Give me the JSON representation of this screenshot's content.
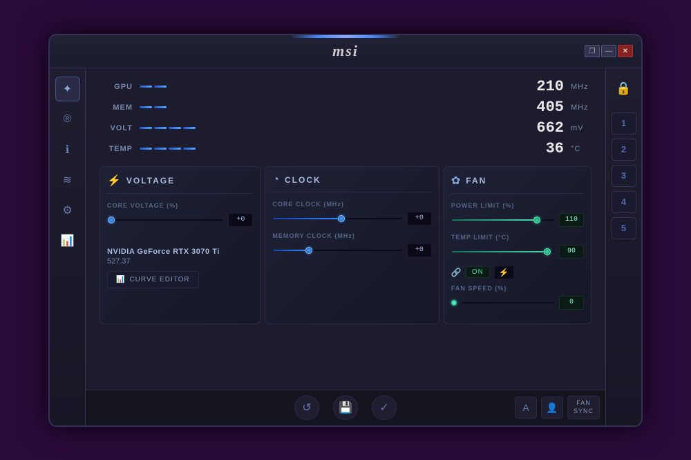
{
  "window": {
    "title": "msi",
    "controls": {
      "minimize": "—",
      "restore": "❐",
      "close": "✕"
    }
  },
  "metrics": [
    {
      "label": "GPU",
      "value": "210",
      "unit": "MHz",
      "barPercent": 15
    },
    {
      "label": "MEM",
      "value": "405",
      "unit": "MHz",
      "barPercent": 25
    },
    {
      "label": "VOLT",
      "value": "662",
      "unit": "mV",
      "barPercent": 35
    },
    {
      "label": "TEMP",
      "value": "36",
      "unit": "°C",
      "barPercent": 30
    }
  ],
  "panels": {
    "voltage": {
      "title": "VOLTAGE",
      "icon": "⚡",
      "coreVoltageLabel": "CORE VOLTAGE  (%)",
      "coreVoltageValue": "+0"
    },
    "clock": {
      "title": "CLOCK",
      "icon": "◔",
      "coreClockLabel": "CORE CLOCK  (MHz)",
      "coreClockValue": "+0",
      "memClockLabel": "MEMORY CLOCK  (MHz)",
      "memClockValue": "+0"
    },
    "fan": {
      "title": "FAN",
      "icon": "✿",
      "powerLimitLabel": "POWER LIMIT  (%)",
      "powerLimitValue": "110",
      "tempLimitLabel": "TEMP LIMIT  (°C)",
      "tempLimitValue": "90",
      "fanSpeedLabel": "FAN SPEED  (%)",
      "fanSpeedValue": "0",
      "toggleLabel": "ON"
    }
  },
  "gpu": {
    "name": "NVIDIA GeForce RTX 3070 Ti",
    "driver": "527.37"
  },
  "curve_editor_label": "CURVE EDITOR",
  "sidebar": {
    "icons": [
      "✦",
      "®",
      "ℹ",
      "≋",
      "⚙",
      "📊"
    ]
  },
  "right_sidebar": {
    "profiles": [
      "1",
      "2",
      "3",
      "4",
      "5"
    ]
  },
  "toolbar": {
    "reset": "↺",
    "save": "💾",
    "apply": "✓"
  },
  "bottom_buttons": {
    "a_label": "A",
    "fan_sync": "FAN\nSYNC"
  }
}
